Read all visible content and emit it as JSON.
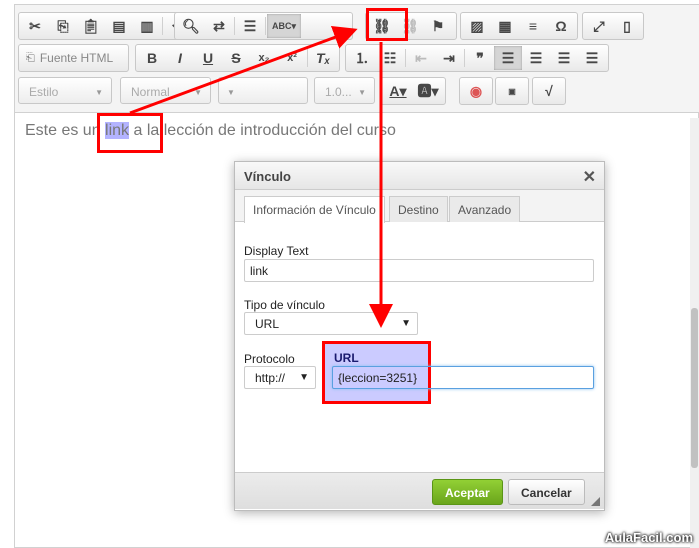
{
  "toolbar": {
    "row1": [
      {
        "group": [
          "cut-icon",
          "copy-icon",
          "paste-icon",
          "paste-text-icon",
          "paste-word-icon",
          "|",
          "undo-icon",
          "redo-icon"
        ]
      },
      {
        "group": [
          "find-icon",
          "replace-icon",
          "|",
          "select-all-icon",
          "|",
          "spellcheck-icon"
        ]
      },
      {
        "group": [
          "link-icon",
          "unlink-icon",
          "anchor-icon"
        ]
      },
      {
        "group": [
          "image-icon",
          "table-icon",
          "horizontal-rule-icon",
          "special-char-icon"
        ]
      },
      {
        "group": [
          "maximize-icon",
          "show-blocks-icon"
        ]
      }
    ],
    "source_label": "Fuente HTML",
    "style_combo": "Estilo",
    "format_combo": "Normal",
    "font_combo": "",
    "line_height_combo": "1.0..."
  },
  "content": {
    "before": "Este es un ",
    "selected": "link",
    "after": " a la lección de introducción del curso"
  },
  "dialog": {
    "title": "Vínculo",
    "tabs": [
      "Información de Vínculo",
      "Destino",
      "Avanzado"
    ],
    "display_text_label": "Display Text",
    "display_text_value": "link",
    "link_type_label": "Tipo de vínculo",
    "link_type_value": "URL",
    "protocol_label": "Protocolo",
    "protocol_value": "http://",
    "url_label": "URL",
    "url_value": "{leccion=3251}",
    "ok_label": "Aceptar",
    "cancel_label": "Cancelar"
  },
  "colors": {
    "annotation": "#ff0000",
    "highlight": "#b3b3ff",
    "ok_button": "#7cbc26"
  },
  "watermark": "AulaFacil.com"
}
